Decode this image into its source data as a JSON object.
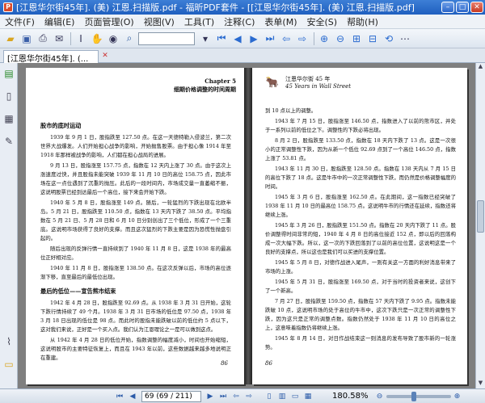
{
  "window": {
    "title": "[江恩华尔街45年]. (美) 江恩.扫描版.pdf - 福昕PDF套件 - [[江恩华尔街45年]. (美) 江恩.扫描版.pdf]",
    "app_icon": "pdf-app-icon"
  },
  "menu": [
    "文件(F)",
    "编辑(E)",
    "页面管理(O)",
    "视图(V)",
    "工具(T)",
    "注释(C)",
    "表单(M)",
    "安全(S)",
    "帮助(H)"
  ],
  "toolbar": {
    "icons": [
      "open-folder-icon",
      "save-icon",
      "print-icon",
      "email-icon",
      "select-text-icon",
      "hand-tool-icon",
      "snapshot-icon",
      "find-icon"
    ],
    "icons2": [
      "first-page-icon",
      "previous-page-icon",
      "next-page-icon",
      "last-page-icon",
      "back-icon",
      "forward-icon",
      "zoom-in-icon",
      "zoom-out-icon",
      "fit-page-icon",
      "fit-width-icon",
      "rotate-icon"
    ]
  },
  "tab": {
    "label": "[江恩华尔街45年]. (..."
  },
  "left_page": {
    "header_line1": "Chapter 5",
    "header_line2": "细期价格调整的时间周期",
    "section1": "股市的底时运动",
    "p1": "1939 年 9 月 1 日，股指跌至 127.50 点。在这一天德特勒入侵波兰，第二次世界大战爆发。人们开始担心战争的影响，开始抛售股票。由于担心像 1914 年至 1918 年那样被战争的影响，人们都在担心战局的进展。",
    "p2": "9 月 13 日，股指涨至 157.75 点，指数在 12 天内上涨了 30 点。由于这次上涨速度过快，并且股指未能突破 1939 年 11 月 10 日的高位 158.75 点，因此市场在这一点位遇到了沉重的抛压。此后的一段时间内，市场成交量一直萎缩不振，这说明股票已经到达最后一个高位，接下来会开始下跌。",
    "p3": "1940 年 5 月 8 日，股指涨至 149 点。随后，一轮猛烈的下跌出现在北欧半岛。5 月 21 日，股指跌至 110.50 点，指数在 13 天内下跌了 38.50 点。平均指数在 5 月 21 日、5 月 28 日和 6 月 10 日分别创出了三个低位，形成了一个三重底。这说明市场获得了良好的支撑。而且这次猛烈的下跌主要是因为恐慌性抛盘引起的。",
    "p4": "随后出现的反弹行情一直持续到了 1940 年 11 月 8 日，这是 1938 年的最高位正好相对应。",
    "p5": "1940 年 11 月 8 日，股指涨至 138.50 点。在这次反弹以后，市场的高位逐渐下移，直至最后的最低位出现。",
    "section2": "最后的低位——宣告熊市结束",
    "p6": "1942 年 4 月 28 日，股指跌至 92.69 点。从 1938 年 3 月 31 日开始，这轮下跌行情持续了 49 个月。1938 年 3 月 31 日市场的低位是 97.50 点，1938 年 3 月 18 日出现的低位是 98 点。而此时的股指未能跌破以前的低位约 5 点以下，这对我们来说，正好是一个买入点。我们认为江恩理论之一是可以做到这点。",
    "p7": "从 1942 年 4 月 28 日的低位开始，指数调整的幅度减小，时间也开始缩短，这说明股市的主要特征恢复上，而且在 1943 年以前，这些数据越来越多地说明正在重建。",
    "folio": "86"
  },
  "right_page": {
    "header_line1": "江恩华尔街 45 年",
    "header_line2": "45 Years in Wall Street",
    "p0": "到 10 点以上的调整。",
    "p1": "1943 年 7 月 15 日，股指涨至 146.50 点，指数进入了以前的熊市区，并处于一系列以前的低位之下。调整性的下跌必将出现。",
    "p2": "8 月 2 日，股指跌至 133.50 点，指数在 18 天内下跌了 13 点。这是一次很小的正常调整性下跌，因为从新一个低位 92.69 点到了一个高位 146.50 点，指数上涨了 53.81 点。",
    "p3": "1943 年 11 月 30 日，股指跌至 128.50 点。指数在 138 天内从 7 月 15 日的高位下跌了 18 点。这是牛市中的一次正常调整性下跌，而仍然是价格调整幅度的时间。",
    "p4": "1945 年 3 月 6 日，股指涨至 162.50 点。在此期间，这一指数已经突破了 1938 年 11 月 10 日的最高位 158.75 点。这说明牛市的行情还在延续，指数还将继续上涨。",
    "p5": "1945 年 3 月 26 日，股指跌至 151.50 点。指数在 20 天内下跌了 11 点。股价调整得时间非常的短，1940 年 4 月 8 日的高位接近 152 点，即以后的回落构成一次大幅下跌。所以，这一次的下跌回落到了以前的高位位置，这说明这是一个良好的支撑点，所以这也是我们可以买进的支撑位置。",
    "p6": "1945 年 5 月 8 日，对德作战进入尾声，一则有关这一方面的利好消息带来了市场的上涨。",
    "p7": "1945 年 5 月 31 日，股指涨至 169.50 点，对于当时的投资者来说，这创下了一个新高。",
    "p8": "7 月 27 日，股指跌至 159.50 点，指数在 57 天内下跌了 9.95 点。指数未能跌破 10 点，这说明市场的处于高位的牛市中，这次下跌只是一次正常的调整性下跌，因为这只是正常的调整点数。指数仍然处于 1938 年 11 月 10 日的高位之上，这意味着指数仍将继续上涨。",
    "p9": "1945 年 8 月 14 日，对日作战结束这一则消息的发布导致了股市新的一轮涨势。",
    "folio": "86"
  },
  "status": {
    "page_field": "69 (69 / 211)",
    "zoom": "180.58%",
    "zoom_fraction": 0.42
  }
}
